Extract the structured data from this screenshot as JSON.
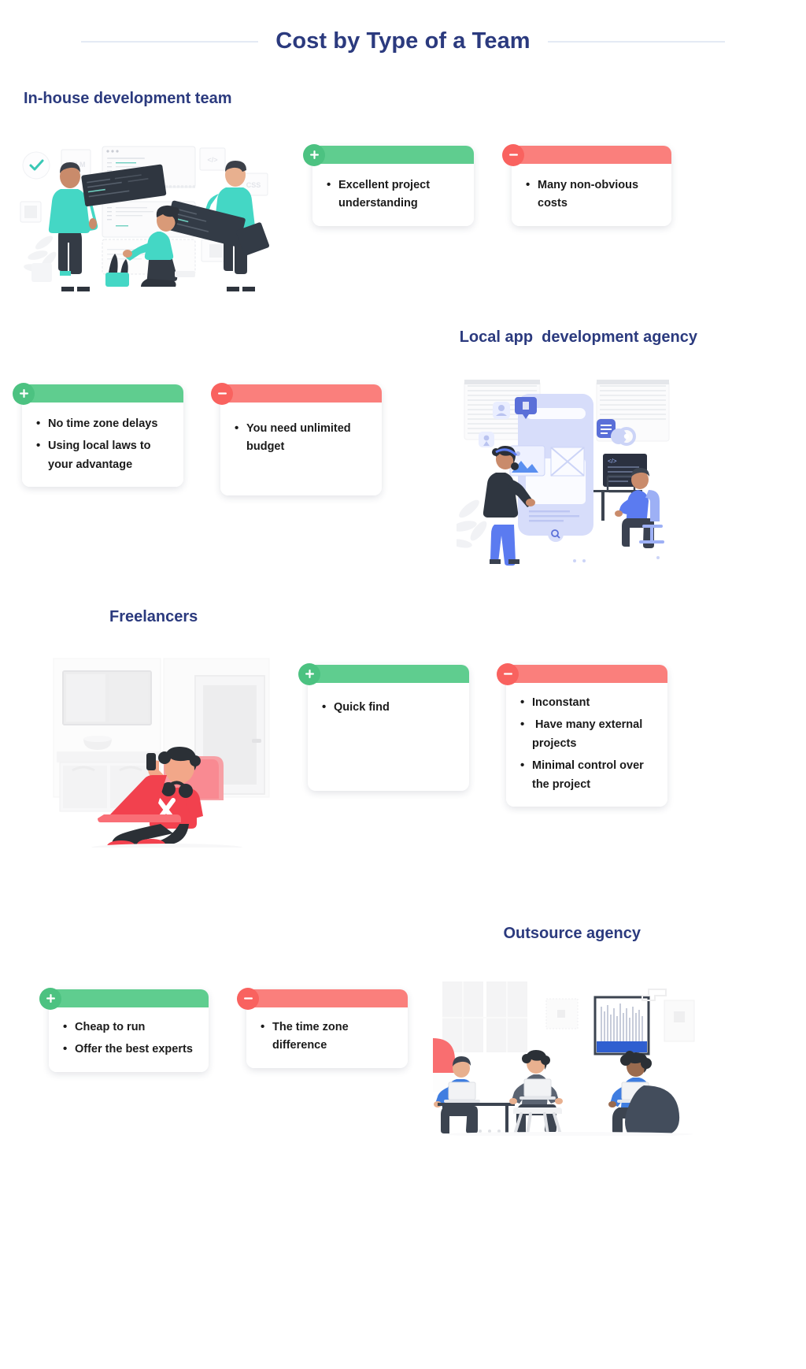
{
  "page": {
    "title": "Cost by Type of a Team",
    "background": "#ffffff",
    "title_color": "#2b3a7e"
  },
  "colors": {
    "heading": "#2b3a7e",
    "positive_bar": "#5fcd8f",
    "positive_badge": "#4cc281",
    "negative_bar": "#fa7f7c",
    "negative_badge": "#f9625f",
    "body_text": "#1b1b1b",
    "rule": "#e4eaf4"
  },
  "sections": [
    {
      "id": "inhouse",
      "heading": "In-house development team",
      "heading_align": "left",
      "illustration": "in-house-team-illustration",
      "pros": {
        "badge": "plus-icon",
        "items": [
          "Excellent project understanding"
        ]
      },
      "cons": {
        "badge": "minus-icon",
        "items": [
          "Many non-obvious costs"
        ]
      }
    },
    {
      "id": "local",
      "heading": "Local app  development agency",
      "heading_align": "right",
      "illustration": "local-agency-illustration",
      "pros": {
        "badge": "plus-icon",
        "items": [
          "No time zone delays",
          "Using local laws to your advantage"
        ]
      },
      "cons": {
        "badge": "minus-icon",
        "items": [
          "You need unlimited budget"
        ]
      }
    },
    {
      "id": "freelancers",
      "heading": "Freelancers",
      "heading_align": "left",
      "illustration": "freelancer-illustration",
      "pros": {
        "badge": "plus-icon",
        "items": [
          "Quick find"
        ]
      },
      "cons": {
        "badge": "minus-icon",
        "items": [
          "Inconstant",
          " Have many external projects",
          "Minimal control over the project"
        ]
      }
    },
    {
      "id": "outsource",
      "heading": "Outsource agency",
      "heading_align": "right",
      "illustration": "outsource-agency-illustration",
      "pros": {
        "badge": "plus-icon",
        "items": [
          "Cheap to run",
          "Offer the best experts"
        ]
      },
      "cons": {
        "badge": "minus-icon",
        "items": [
          "The time zone difference"
        ]
      }
    }
  ],
  "illustration_labels": {
    "inhouse_tag_1": "HTLM",
    "inhouse_tag_2": "CSS"
  }
}
